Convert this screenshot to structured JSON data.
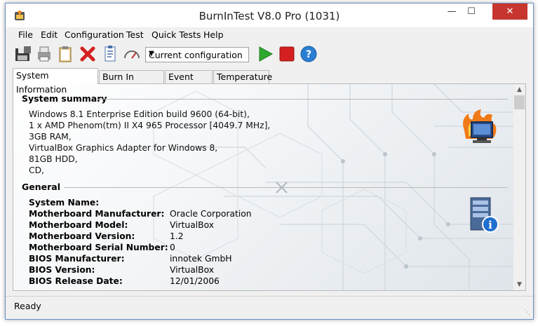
{
  "window": {
    "title": "BurnInTest V8.0 Pro (1031)"
  },
  "menu": [
    "File",
    "Edit",
    "Configuration",
    "Test",
    "Quick Tests",
    "Help"
  ],
  "toolbar": {
    "config_value": "Current configuration",
    "icons": [
      "save-icon",
      "printer-icon",
      "clipboard-icon",
      "stop-x-icon",
      "checklist-icon",
      "gauge-icon",
      "play-icon",
      "stop-icon",
      "help-icon"
    ]
  },
  "tabs": [
    "System Information",
    "Burn In Results",
    "Event Log",
    "Temperature"
  ],
  "summary": {
    "title": "System summary",
    "lines": [
      "Windows 8.1 Enterprise Edition build 9600 (64-bit),",
      "1 x AMD Phenom(tm) II X4 965 Processor [4049.7 MHz],",
      "3GB RAM,",
      "VirtualBox Graphics Adapter for Windows 8,",
      "81GB HDD,",
      "CD,"
    ]
  },
  "general": {
    "title": "General",
    "rows": [
      {
        "label": "System Name:",
        "value": ""
      },
      {
        "label": "Motherboard Manufacturer:",
        "value": "Oracle Corporation"
      },
      {
        "label": "Motherboard Model:",
        "value": "VirtualBox"
      },
      {
        "label": "Motherboard Version:",
        "value": "1.2"
      },
      {
        "label": "Motherboard Serial Number:",
        "value": "0"
      },
      {
        "label": "BIOS Manufacturer:",
        "value": "innotek GmbH"
      },
      {
        "label": "BIOS Version:",
        "value": "VirtualBox"
      },
      {
        "label": "BIOS Release Date:",
        "value": "12/01/2006"
      }
    ]
  },
  "status": {
    "text": "Ready"
  },
  "colors": {
    "accent_close": "#c7352f",
    "play_green": "#2fa82f",
    "stop_red": "#d42020",
    "help_blue": "#2a7fd4"
  }
}
